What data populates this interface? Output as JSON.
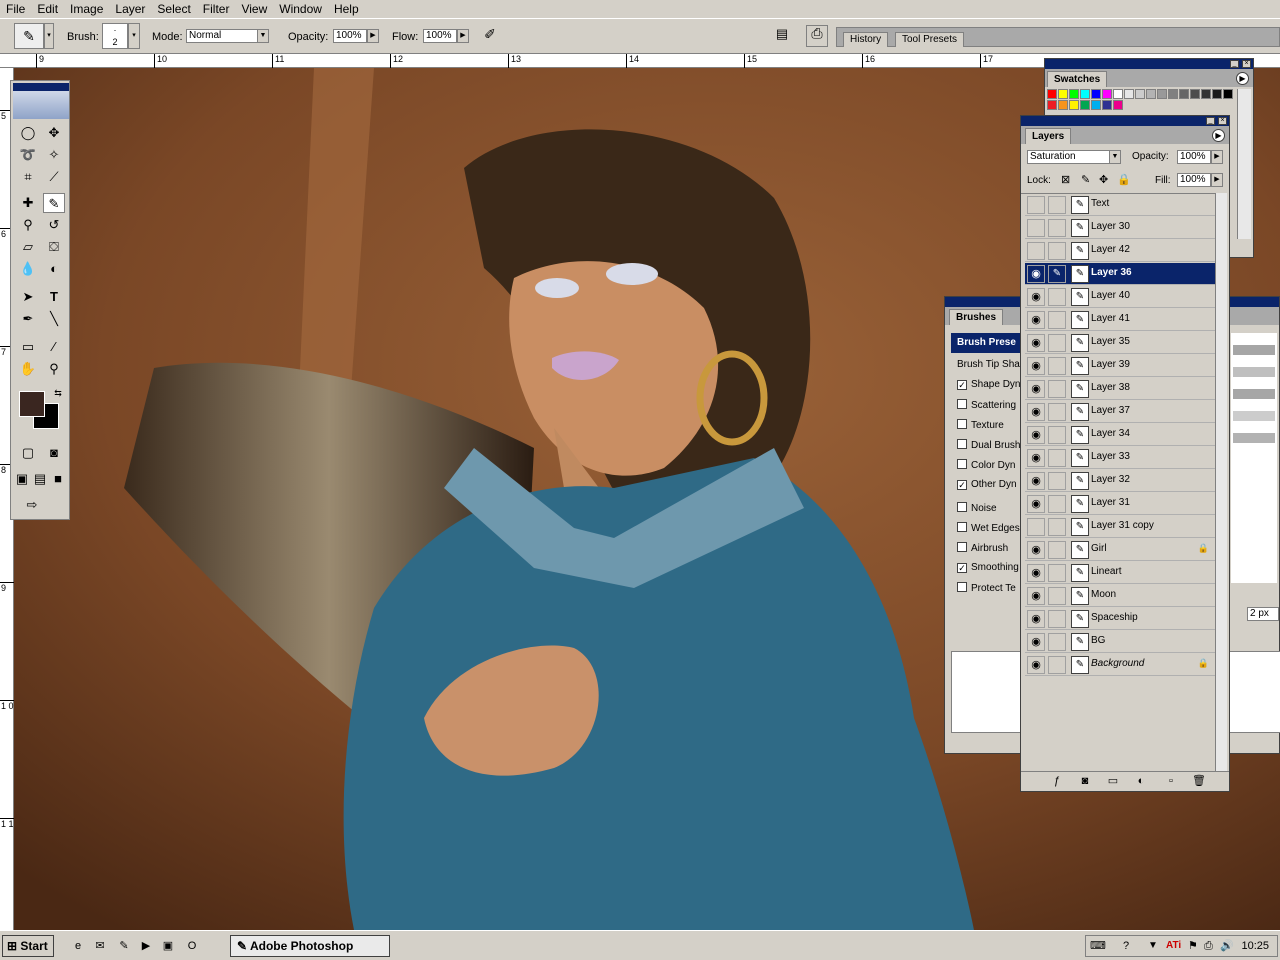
{
  "menu": [
    "File",
    "Edit",
    "Image",
    "Layer",
    "Select",
    "Filter",
    "View",
    "Window",
    "Help"
  ],
  "options": {
    "brush_label": "Brush:",
    "brush_size": "2",
    "mode_label": "Mode:",
    "mode_value": "Normal",
    "opacity_label": "Opacity:",
    "opacity_value": "100%",
    "flow_label": "Flow:",
    "flow_value": "100%"
  },
  "palette_well": {
    "tabs": [
      "History",
      "Tool Presets"
    ]
  },
  "ruler": {
    "top": [
      "9",
      "10",
      "11",
      "12",
      "13",
      "14",
      "15",
      "16",
      "17"
    ],
    "left": [
      "5",
      "6",
      "7",
      "8",
      "9",
      "1\n0",
      "1\n1"
    ]
  },
  "swatches": {
    "title": "Swatches",
    "colors": [
      "#ff0000",
      "#ffff00",
      "#00ff00",
      "#00ffff",
      "#0000ff",
      "#ff00ff",
      "#ffffff",
      "#e6e6e6",
      "#cccccc",
      "#b3b3b3",
      "#999999",
      "#808080",
      "#666666",
      "#4d4d4d",
      "#333333",
      "#1a1a1a",
      "#000000",
      "#ed1c24",
      "#f7941d",
      "#fff200",
      "#00a651",
      "#00aeef",
      "#2e3192",
      "#ec008c"
    ]
  },
  "layers": {
    "title": "Layers",
    "blend_mode": "Saturation",
    "opacity_label": "Opacity:",
    "opacity_value": "100%",
    "lock_label": "Lock:",
    "fill_label": "Fill:",
    "fill_value": "100%",
    "items": [
      {
        "name": "Text",
        "visible": false
      },
      {
        "name": "Layer 30",
        "visible": false
      },
      {
        "name": "Layer 42",
        "visible": false
      },
      {
        "name": "Layer 36",
        "visible": true,
        "selected": true
      },
      {
        "name": "Layer 40",
        "visible": true
      },
      {
        "name": "Layer 41",
        "visible": true
      },
      {
        "name": "Layer 35",
        "visible": true
      },
      {
        "name": "Layer 39",
        "visible": true
      },
      {
        "name": "Layer 38",
        "visible": true
      },
      {
        "name": "Layer 37",
        "visible": true
      },
      {
        "name": "Layer 34",
        "visible": true
      },
      {
        "name": "Layer 33",
        "visible": true
      },
      {
        "name": "Layer 32",
        "visible": true
      },
      {
        "name": "Layer 31",
        "visible": true
      },
      {
        "name": "Layer 31 copy",
        "visible": false
      },
      {
        "name": "Girl",
        "visible": true,
        "locked": true
      },
      {
        "name": "Lineart",
        "visible": true
      },
      {
        "name": "Moon",
        "visible": true
      },
      {
        "name": "Spaceship",
        "visible": true
      },
      {
        "name": "BG",
        "visible": true
      },
      {
        "name": "Background",
        "visible": true,
        "locked": true
      }
    ]
  },
  "brushes": {
    "title": "Brushes",
    "presets_label": "Brush Prese",
    "size_value": "2 px",
    "options": [
      {
        "label": "Brush Tip Sha",
        "checkbox": false
      },
      {
        "label": "Shape Dyn",
        "checkbox": true,
        "checked": true
      },
      {
        "label": "Scattering",
        "checkbox": true,
        "checked": false
      },
      {
        "label": "Texture",
        "checkbox": true,
        "checked": false
      },
      {
        "label": "Dual Brush",
        "checkbox": true,
        "checked": false
      },
      {
        "label": "Color Dyn",
        "checkbox": true,
        "checked": false
      },
      {
        "label": "Other Dyn",
        "checkbox": true,
        "checked": true
      },
      {
        "label": "Noise",
        "checkbox": true,
        "checked": false
      },
      {
        "label": "Wet Edges",
        "checkbox": true,
        "checked": false
      },
      {
        "label": "Airbrush",
        "checkbox": true,
        "checked": false
      },
      {
        "label": "Smoothing",
        "checkbox": true,
        "checked": true
      },
      {
        "label": "Protect Te",
        "checkbox": true,
        "checked": false
      }
    ]
  },
  "taskbar": {
    "start": "Start",
    "window": "Adobe Photoshop",
    "clock": "10:25"
  }
}
